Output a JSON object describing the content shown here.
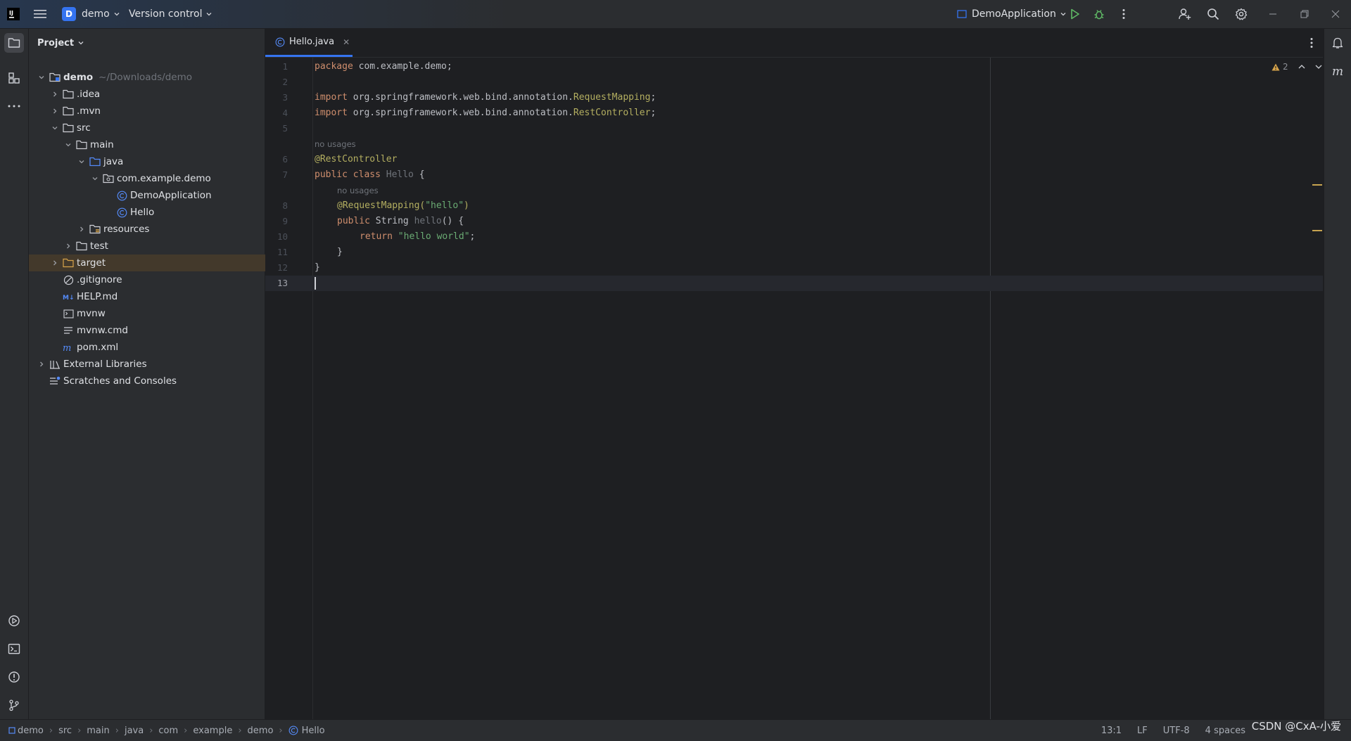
{
  "titlebar": {
    "project_initial": "D",
    "project_name": "demo",
    "vcs_label": "Version control",
    "run_config": "DemoApplication"
  },
  "project_panel": {
    "title": "Project",
    "tree": [
      {
        "label": "demo",
        "extra": "~/Downloads/demo"
      },
      {
        "label": ".idea"
      },
      {
        "label": ".mvn"
      },
      {
        "label": "src"
      },
      {
        "label": "main"
      },
      {
        "label": "java"
      },
      {
        "label": "com.example.demo"
      },
      {
        "label": "DemoApplication"
      },
      {
        "label": "Hello"
      },
      {
        "label": "resources"
      },
      {
        "label": "test"
      },
      {
        "label": "target"
      },
      {
        "label": ".gitignore"
      },
      {
        "label": "HELP.md"
      },
      {
        "label": "mvnw"
      },
      {
        "label": "mvnw.cmd"
      },
      {
        "label": "pom.xml"
      },
      {
        "label": "External Libraries"
      },
      {
        "label": "Scratches and Consoles"
      }
    ]
  },
  "editor": {
    "tab_label": "Hello.java",
    "inspection_count": "2",
    "hints": [
      "no usages",
      "no usages"
    ],
    "line_numbers": [
      "1",
      "2",
      "3",
      "4",
      "5",
      "6",
      "7",
      "8",
      "9",
      "10",
      "11",
      "12",
      "13"
    ],
    "code": {
      "l1_kw": "package",
      "l1_rest": " com.example.demo;",
      "l3_kw": "import",
      "l3_pkg": " org.springframework.web.bind.annotation.",
      "l3_cls": "RequestMapping",
      "l3_end": ";",
      "l4_kw": "import",
      "l4_pkg": " org.springframework.web.bind.annotation.",
      "l4_cls": "RestController",
      "l4_end": ";",
      "l6_ann": "@RestController",
      "l7_kw": "public class",
      "l7_name": " Hello",
      "l7_end": " {",
      "l8_ann": "@RequestMapping(",
      "l8_str": "\"hello\"",
      "l8_end": ")",
      "l9_kw": "public",
      "l9_type": " String ",
      "l9_fn": "hello",
      "l9_end": "() {",
      "l10_kw": "return",
      "l10_str": " \"hello world\"",
      "l10_end": ";",
      "l11": "}",
      "l12": "}"
    }
  },
  "statusbar": {
    "breadcrumbs": [
      "demo",
      "src",
      "main",
      "java",
      "com",
      "example",
      "demo",
      "Hello"
    ],
    "position": "13:1",
    "line_sep": "LF",
    "encoding": "UTF-8",
    "indent": "4 spaces",
    "watermark": "CSDN @CxA-小爱"
  }
}
